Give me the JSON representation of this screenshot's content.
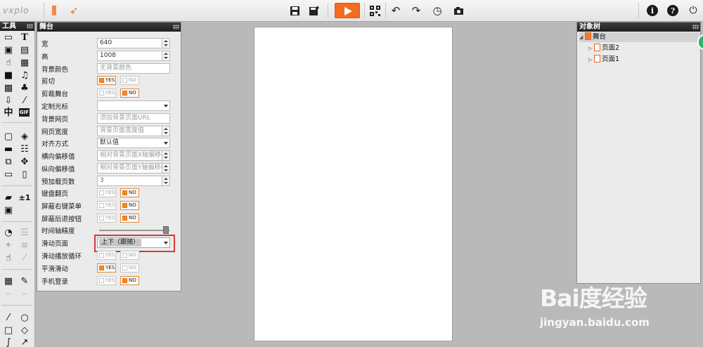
{
  "app": {
    "logo": "vxplo"
  },
  "toolbar": {
    "qr_label": "QR"
  },
  "tools_panel": {
    "title": "工具",
    "icon_text_zh": "中",
    "icon_text_gif": "GIF",
    "icon_text_pm": "±1"
  },
  "stage_panel": {
    "title": "舞台",
    "rows": [
      {
        "label": "宽",
        "value": "640"
      },
      {
        "label": "高",
        "value": "1008"
      },
      {
        "label": "背景颜色",
        "placeholder": "无背景颜色"
      },
      {
        "label": "剪切",
        "yes": "YES",
        "no": "NO"
      },
      {
        "label": "剪裁舞台",
        "yes": "YES",
        "no": "NO"
      },
      {
        "label": "定制光标",
        "value": ""
      },
      {
        "label": "背景网页",
        "placeholder": "添加背景页面URL"
      },
      {
        "label": "网页宽度",
        "placeholder": "背景页面宽度值"
      },
      {
        "label": "对齐方式",
        "value": "默认值"
      },
      {
        "label": "横向偏移值",
        "placeholder": "相对背景页面X轴偏移("
      },
      {
        "label": "纵向偏移值",
        "placeholder": "相对背景页面Y轴偏移("
      },
      {
        "label": "预加载页数",
        "value": "3"
      },
      {
        "label": "键盘翻页",
        "yes": "YES",
        "no": "NO"
      },
      {
        "label": "屏蔽右键菜单",
        "yes": "YES",
        "no": "NO"
      },
      {
        "label": "屏蔽后退按钮",
        "yes": "YES",
        "no": "NO"
      },
      {
        "label": "时间轴精度"
      },
      {
        "label": "滑动页面",
        "value": "上下（跟随）"
      },
      {
        "label": "滑动播放循环",
        "yes": "YES",
        "no": "NO"
      },
      {
        "label": "平滑滑动",
        "yes": "YES",
        "no": "NO"
      },
      {
        "label": "手机登录",
        "yes": "YES",
        "no": "NO"
      }
    ]
  },
  "object_tree": {
    "title": "对象树",
    "root": "舞台",
    "pages": [
      "页面2",
      "页面1"
    ]
  },
  "watermark": {
    "main": "Bai度经验",
    "sub": "jingyan.baidu.com"
  },
  "colors": {
    "accent": "#f26c1f",
    "highlight_box": "#d53a3a",
    "toggle_on": "#f28a2c"
  }
}
